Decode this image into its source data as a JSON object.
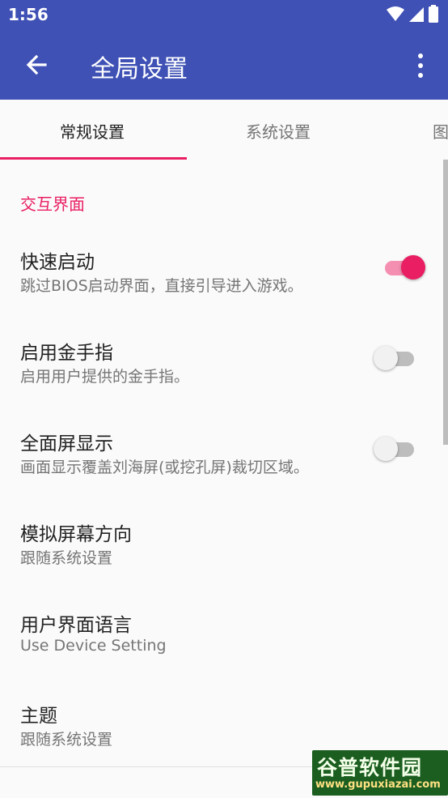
{
  "status_bar": {
    "time": "1:56"
  },
  "app_bar": {
    "title": "全局设置"
  },
  "tabs": [
    {
      "label": "常规设置"
    },
    {
      "label": "系统设置"
    },
    {
      "label": "图"
    }
  ],
  "section": {
    "header": "交互界面"
  },
  "preferences": [
    {
      "title": "快速启动",
      "summary": "跳过BIOS启动界面，直接引导进入游戏。",
      "switch": true
    },
    {
      "title": "启用金手指",
      "summary": "启用用户提供的金手指。",
      "switch": false
    },
    {
      "title": "全面屏显示",
      "summary": "画面显示覆盖刘海屏(或挖孔屏)裁切区域。",
      "switch": false
    },
    {
      "title": "模拟屏幕方向",
      "summary": "跟随系统设置"
    },
    {
      "title": "用户界面语言",
      "summary": "Use Device Setting"
    },
    {
      "title": "主题",
      "summary": "跟随系统设置"
    }
  ],
  "watermark": {
    "line1": "谷普软件园",
    "line2": "www.gupuxiazai.com"
  },
  "colors": {
    "primary": "#3f51b5",
    "accent": "#e91e63"
  }
}
